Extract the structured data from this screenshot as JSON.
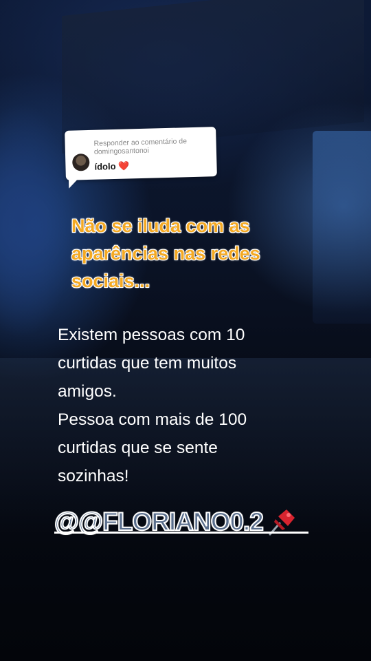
{
  "reply": {
    "header": "Responder ao comentário de domingosantonoi",
    "comment": "ídolo",
    "heart": "❤️"
  },
  "headline": "Não se iluda com as aparências nas redes sociais...",
  "body_lines": [
    "Existem pessoas com 10",
    "curtidas que tem muitos",
    "amigos.",
    "Pessoa com mais de 100",
    "curtidas que se sente",
    "sozinhas!"
  ],
  "handle": {
    "text": "@@FLORIANO0.2",
    "icon": "pushpin-icon"
  },
  "colors": {
    "headline": "#f4a923",
    "handle_fill": "#5a6e8c",
    "heart": "#e0303a"
  }
}
